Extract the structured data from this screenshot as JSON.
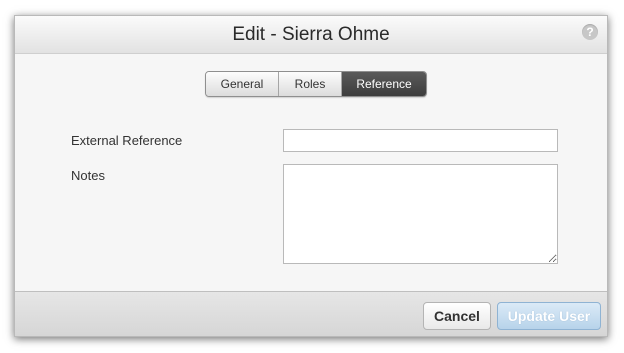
{
  "dialog": {
    "title": "Edit - Sierra Ohme",
    "help_icon": "question-mark-icon"
  },
  "tabs": [
    {
      "label": "General",
      "active": false
    },
    {
      "label": "Roles",
      "active": false
    },
    {
      "label": "Reference",
      "active": true
    }
  ],
  "form": {
    "external_reference": {
      "label": "External Reference",
      "value": ""
    },
    "notes": {
      "label": "Notes",
      "value": ""
    }
  },
  "footer": {
    "cancel_label": "Cancel",
    "update_label": "Update User"
  },
  "colors": {
    "active_tab": "#4a4a4a",
    "primary_button": "#b7d3ea"
  }
}
